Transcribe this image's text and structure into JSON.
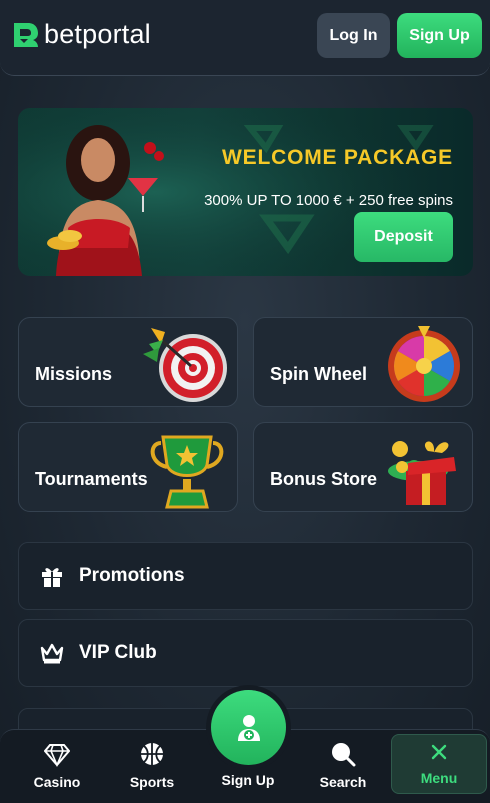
{
  "header": {
    "logo_text": "betportal",
    "login_label": "Log In",
    "signup_label": "Sign Up"
  },
  "banner": {
    "title": "WELCOME PACKAGE",
    "subtitle": "300% UP TO 1000 € + 250 free spins",
    "deposit_label": "Deposit"
  },
  "tiles": [
    {
      "label": "Missions",
      "icon": "target-dart-icon"
    },
    {
      "label": "Spin Wheel",
      "icon": "spin-wheel-icon"
    },
    {
      "label": "Tournaments",
      "icon": "trophy-icon"
    },
    {
      "label": "Bonus Store",
      "icon": "gift-box-icon"
    }
  ],
  "list": [
    {
      "label": "Promotions",
      "icon": "gift-icon"
    },
    {
      "label": "VIP Club",
      "icon": "crown-icon"
    }
  ],
  "bottom_nav": {
    "items": [
      {
        "label": "Casino",
        "icon": "diamond-icon"
      },
      {
        "label": "Sports",
        "icon": "basketball-icon"
      },
      {
        "label": "Sign Up",
        "icon": "user-add-icon"
      },
      {
        "label": "Search",
        "icon": "search-icon"
      },
      {
        "label": "Menu",
        "icon": "close-icon"
      }
    ]
  },
  "colors": {
    "accent": "#3ddc7e",
    "banner_title": "#f6c928",
    "background": "#1e2833"
  }
}
